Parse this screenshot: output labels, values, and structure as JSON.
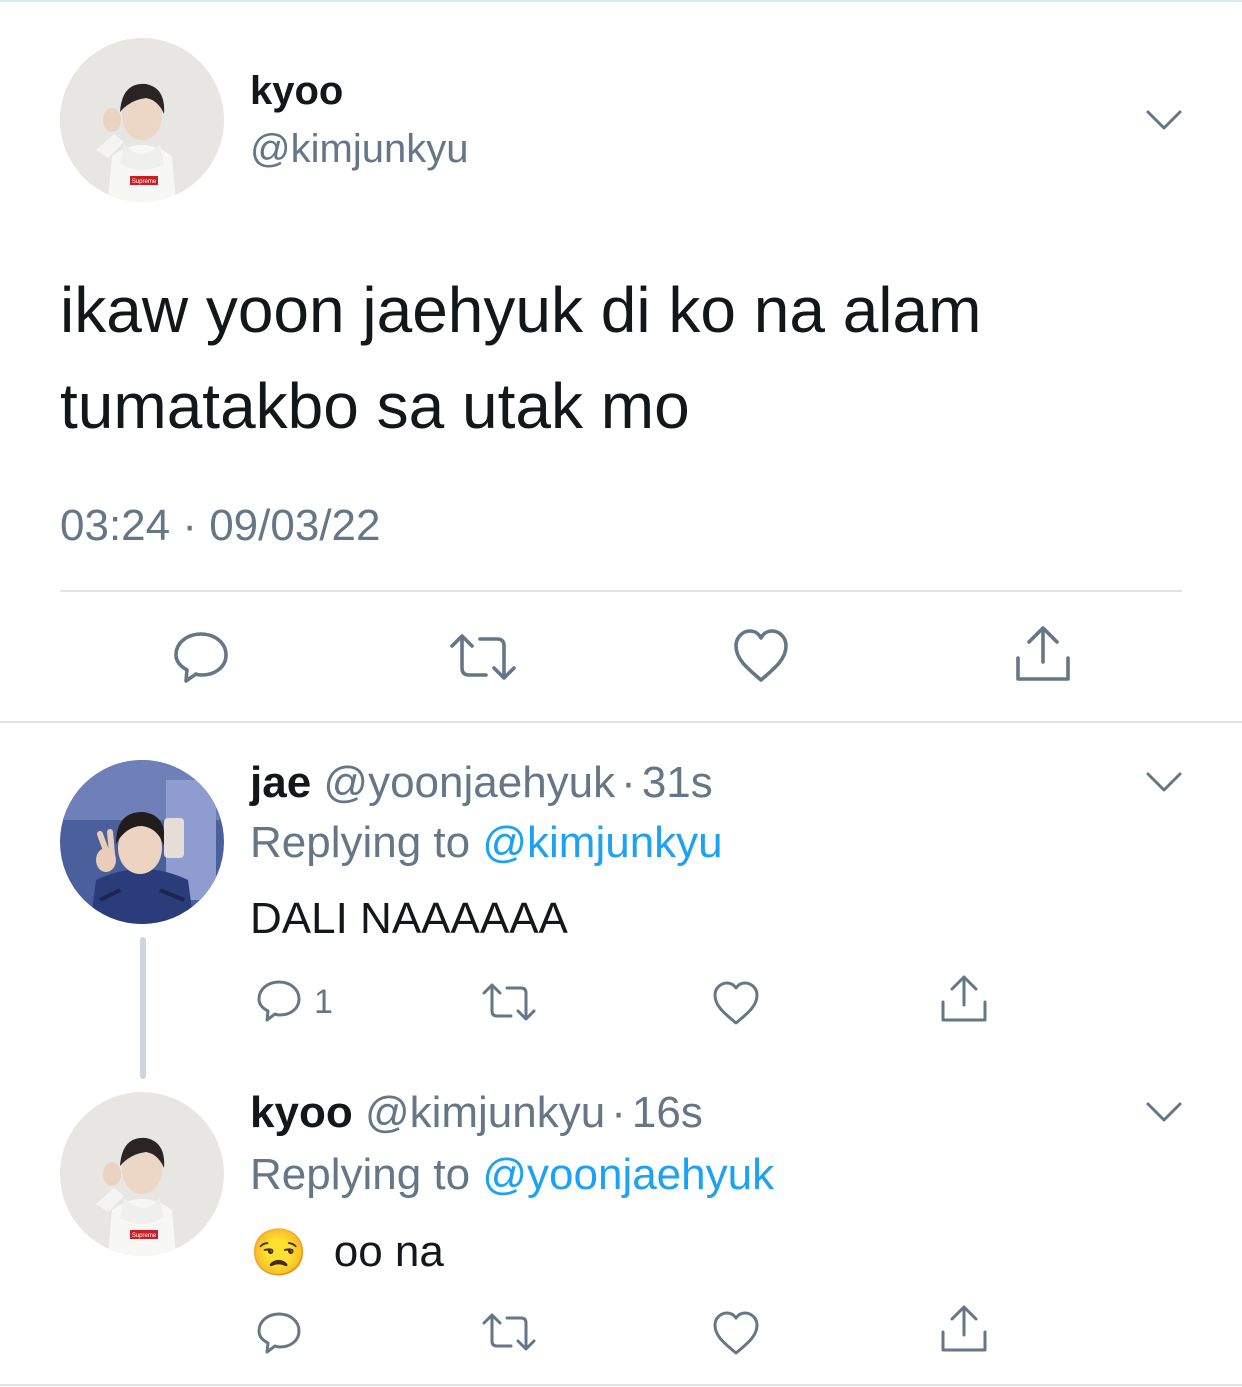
{
  "main_tweet": {
    "display_name": "kyoo",
    "handle": "@kimjunkyu",
    "text_line1": "ikaw yoon jaehyuk di ko na alam",
    "text_line2": "tumatakbo sa utak mo",
    "timestamp": "03:24 · 09/03/22",
    "avatar_logo_text": "Supreme"
  },
  "replies": [
    {
      "display_name": "jae",
      "handle": "@yoonjaehyuk",
      "dot": "·",
      "time": "31s",
      "replying_prefix": "Replying to ",
      "replying_to": "@kimjunkyu",
      "text": "DALI NAAAAAA",
      "reply_count": "1"
    },
    {
      "display_name": "kyoo",
      "handle": "@kimjunkyu",
      "dot": "·",
      "time": "16s",
      "replying_prefix": "Replying to ",
      "replying_to": "@yoonjaehyuk",
      "emoji": "😒",
      "text": "oo na",
      "avatar_logo_text": "Supreme"
    }
  ],
  "colors": {
    "text": "#14171a",
    "muted": "#657786",
    "link": "#1da1f2",
    "divider": "#dfe3e8"
  }
}
